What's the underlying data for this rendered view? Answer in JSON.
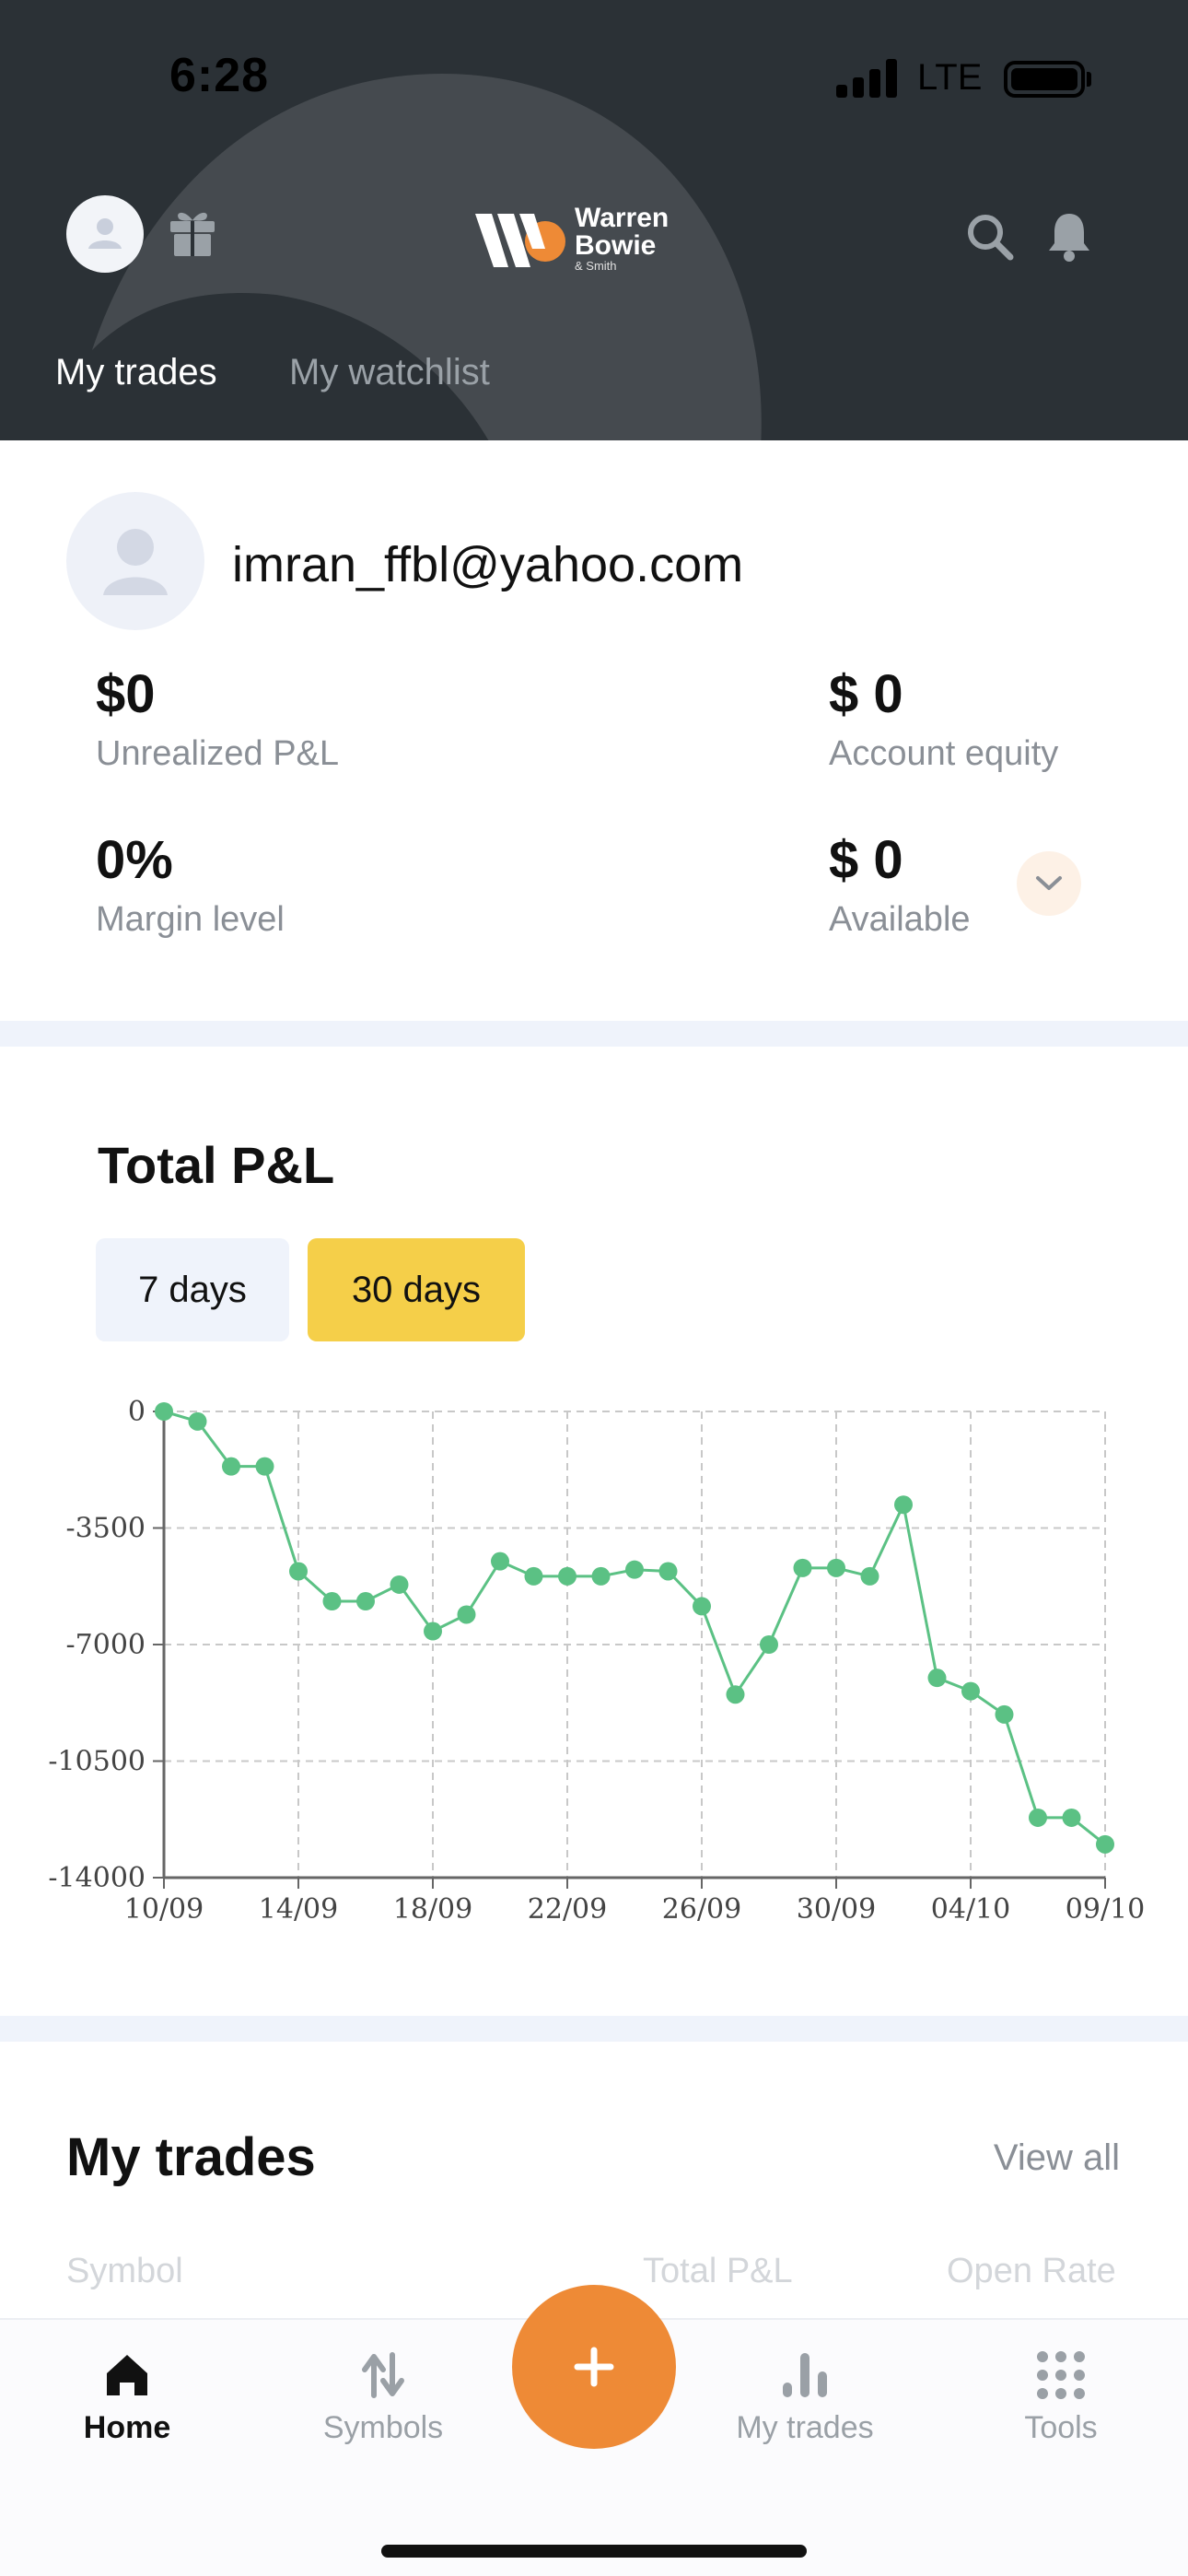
{
  "status_bar": {
    "time": "6:28",
    "network": "LTE"
  },
  "brand": {
    "line1": "Warren",
    "line2": "Bowie",
    "line3": "& Smith",
    "accent": "#ee8a36"
  },
  "header": {
    "tabs": [
      {
        "label": "My trades",
        "active": true
      },
      {
        "label": "My watchlist",
        "active": false
      }
    ],
    "icons": [
      "avatar",
      "gift-icon",
      "search-icon",
      "bell-icon"
    ]
  },
  "account": {
    "email": "imran_ffbl@yahoo.com",
    "stats": [
      {
        "value": "$0",
        "label": "Unrealized P&L"
      },
      {
        "value": "$ 0",
        "label": "Account equity"
      },
      {
        "value": "0%",
        "label": "Margin level"
      },
      {
        "value": "$ 0",
        "label": "Available"
      }
    ]
  },
  "pnl": {
    "title": "Total P&L",
    "ranges": [
      {
        "label": "7 days",
        "selected": false
      },
      {
        "label": "30 days",
        "selected": true
      }
    ],
    "selected_color": "#f5cf49"
  },
  "chart_data": {
    "type": "line",
    "title": "",
    "xlabel": "",
    "ylabel": "",
    "line_color": "#5bc184",
    "grid": true,
    "ylim": [
      -14000,
      0
    ],
    "y_ticks": [
      0,
      -3500,
      -7000,
      -10500,
      -14000
    ],
    "x_tick_labels": [
      "10/09",
      "14/09",
      "18/09",
      "22/09",
      "26/09",
      "30/09",
      "04/10",
      "09/10"
    ],
    "x_tick_day_index": [
      0,
      4,
      8,
      12,
      16,
      20,
      24,
      28
    ],
    "series": [
      {
        "name": "",
        "values": [
          0,
          -300,
          -1650,
          -1650,
          -4800,
          -5700,
          -5700,
          -5200,
          -6600,
          -6100,
          -4500,
          -4950,
          -4950,
          -4950,
          -4750,
          -4800,
          -5850,
          -8500,
          -7000,
          -4700,
          -4700,
          -4950,
          -2800,
          -8000,
          -8400,
          -9100,
          -12200,
          -12200,
          -13000
        ]
      }
    ]
  },
  "trades": {
    "title": "My trades",
    "view_all": "View all",
    "columns": [
      "Symbol",
      "Total P&L",
      "Open Rate"
    ]
  },
  "bottom_nav": {
    "items": [
      {
        "label": "Home",
        "icon": "home-icon",
        "active": true
      },
      {
        "label": "Symbols",
        "icon": "swap-arrows-icon",
        "active": false
      },
      {
        "label": "My trades",
        "icon": "bar-chart-icon",
        "active": false
      },
      {
        "label": "Tools",
        "icon": "grid-icon",
        "active": false
      }
    ],
    "fab_label": "+"
  }
}
